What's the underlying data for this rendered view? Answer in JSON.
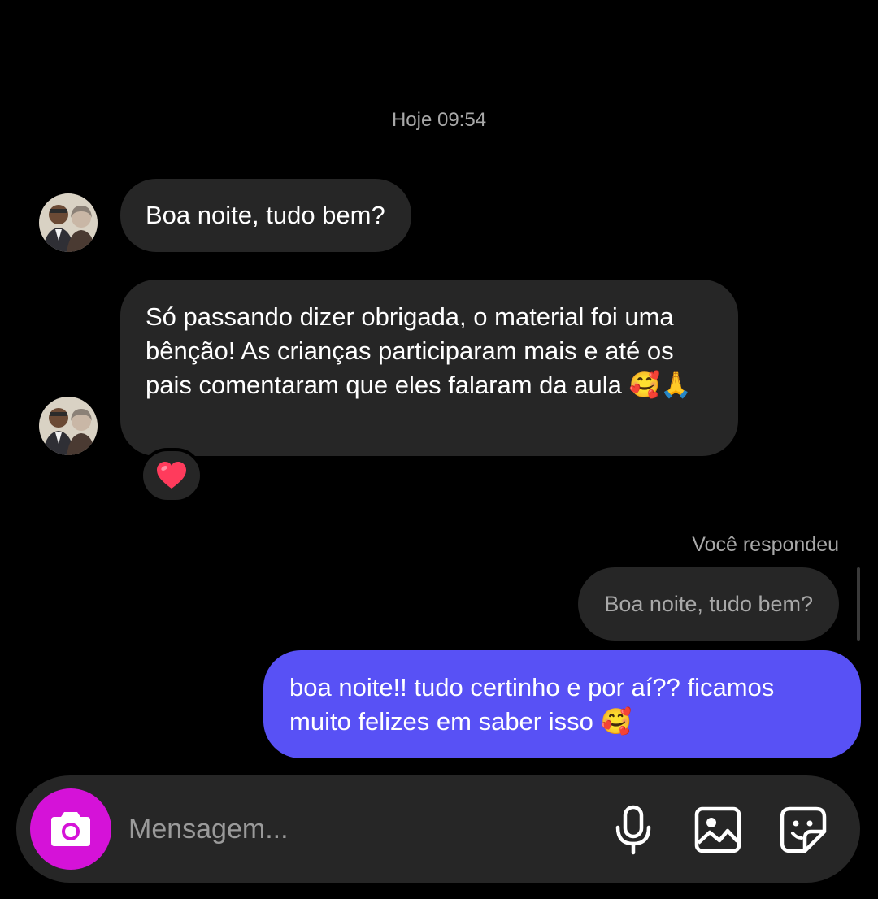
{
  "conversation": {
    "timestamp": "Hoje 09:54",
    "messages": [
      {
        "from": "contact",
        "text": "Boa noite, tudo bem?"
      },
      {
        "from": "contact",
        "text": "Só passando dizer obrigada, o material foi uma bênção! As crianças participaram mais e até os pais comentaram que eles falaram da aula",
        "emojis": "🥰🙏",
        "reaction": "❤️"
      }
    ],
    "reply": {
      "label": "Você respondeu",
      "quoted_text": "Boa noite, tudo bem?",
      "text": "boa noite!! tudo certinho e por aí?? ficamos muito felizes em saber isso",
      "emoji": "🥰"
    }
  },
  "composer": {
    "placeholder": "Mensagem...",
    "icons": [
      "camera-icon",
      "microphone-icon",
      "gallery-icon",
      "sticker-icon"
    ]
  },
  "colors": {
    "background": "#000000",
    "incoming_bubble": "#262626",
    "outgoing_bubble": "#5851f5",
    "camera_button": "#d512d8",
    "secondary_text": "#a8a8a8",
    "reaction_heart": "#ff3b5c"
  }
}
